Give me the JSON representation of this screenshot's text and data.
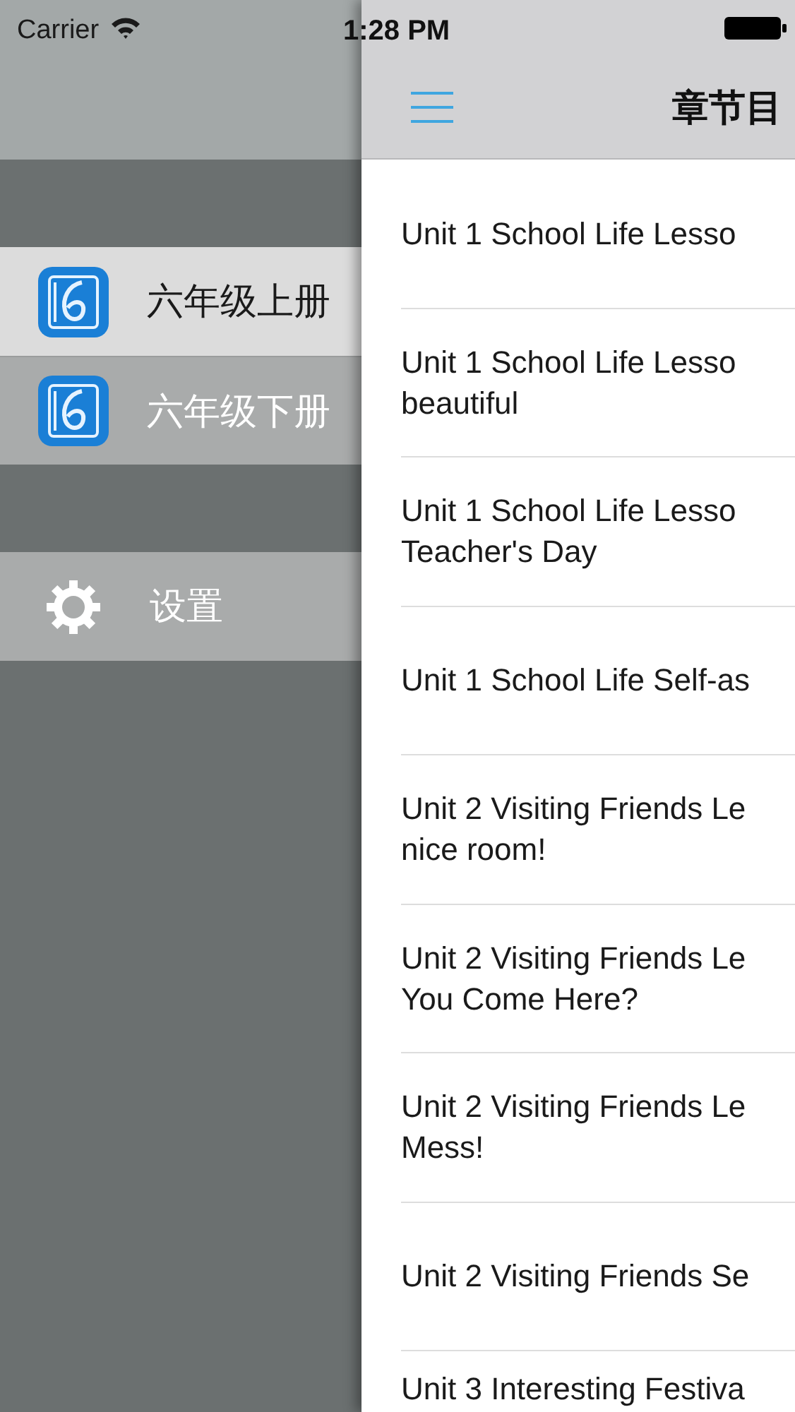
{
  "status_bar": {
    "carrier": "Carrier",
    "time": "1:28 PM"
  },
  "drawer": {
    "books": [
      {
        "label": "六年级上册",
        "selected": true
      },
      {
        "label": "六年级下册",
        "selected": false
      }
    ],
    "settings": {
      "label": "设置"
    }
  },
  "nav_bar": {
    "title": "章节目"
  },
  "chapters": [
    {
      "lines": [
        "Unit 1 School Life Lesso"
      ]
    },
    {
      "lines": [
        "Unit 1 School Life Lesso",
        "beautiful"
      ]
    },
    {
      "lines": [
        "Unit 1 School Life Lesso",
        "Teacher's Day"
      ]
    },
    {
      "lines": [
        "Unit 1 School Life Self-as"
      ]
    },
    {
      "lines": [
        "Unit 2 Visiting Friends Le",
        "nice room!"
      ]
    },
    {
      "lines": [
        "Unit 2 Visiting Friends Le",
        "You Come Here?"
      ]
    },
    {
      "lines": [
        "Unit 2 Visiting Friends Le",
        "Mess!"
      ]
    },
    {
      "lines": [
        "Unit 2 Visiting Friends Se"
      ]
    },
    {
      "lines": [
        "Unit 3 Interesting Festiva"
      ]
    }
  ]
}
